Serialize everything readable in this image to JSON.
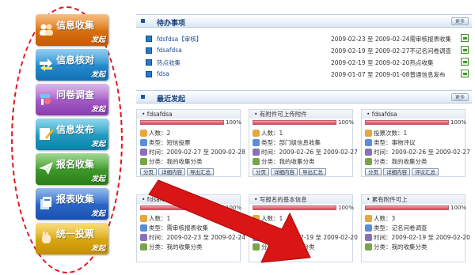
{
  "sidebar": {
    "tiles": [
      {
        "label": "信息收集",
        "launch": "发起",
        "color": "#f08a1c",
        "dark": "#c45a06",
        "icon": "people-icon"
      },
      {
        "label": "信息核对",
        "launch": "发起",
        "color": "#3aa7e6",
        "dark": "#1370b5",
        "icon": "exchange-arrows-icon"
      },
      {
        "label": "问卷调查",
        "launch": "发起",
        "color": "#c07ddb",
        "dark": "#8a3cb0",
        "icon": "tools-icon"
      },
      {
        "label": "信息发布",
        "launch": "发起",
        "color": "#35b8dc",
        "dark": "#0f80a8",
        "icon": "edit-pen-icon"
      },
      {
        "label": "报名收集",
        "launch": "发起",
        "color": "#52b83a",
        "dark": "#2a7d18",
        "icon": "paper-plane-icon"
      },
      {
        "label": "报表收集",
        "launch": "发起",
        "color": "#3d7fe0",
        "dark": "#1a4fae",
        "icon": "document-stack-icon"
      },
      {
        "label": "统一投票",
        "launch": "发起",
        "color": "#f2c21d",
        "dark": "#c48e06",
        "icon": "hand-icon"
      }
    ]
  },
  "todo": {
    "title": "待办事项",
    "more": "更多",
    "items": [
      {
        "name": "fdsfdsa【审核】",
        "desc": "2009-02-23 至 2009-02-24需审核报表收集"
      },
      {
        "name": "fdsafdsa",
        "desc": "2009-02-19 至 2009-02-27不记名问卷调查"
      },
      {
        "name": "热点收集",
        "desc": "2009-02-19 至 2009-02-20热点收集"
      },
      {
        "name": "fdsa",
        "desc": "2009-01-07 至 2009-01-08普通信息发布"
      }
    ]
  },
  "recent": {
    "title": "最近发起",
    "more": "更多",
    "cards": [
      {
        "title": "fdsafdsa",
        "percent": "100%",
        "fill": 1.0,
        "lines": [
          "人数：2",
          "类型：短信投票",
          "时间：2009-02-27 至 2009-02-28",
          "分类：我的收集分类"
        ],
        "buttons": [
          "分页",
          "详细内容",
          "导出汇总"
        ]
      },
      {
        "title": "有附件可上传附件",
        "percent": "100%",
        "fill": 1.0,
        "lines": [
          "人数：1",
          "类型：部门级信息收集",
          "时间：2009-02-26 至 2009-02-27",
          "分类：我的收集分类"
        ],
        "buttons": [
          "分页",
          "详细内容",
          "导出汇总"
        ]
      },
      {
        "title": "fdsafdsa",
        "percent": "100%",
        "fill": 1.0,
        "lines": [
          "投票次数：1",
          "类型：事物评议",
          "时间：2009-02-26 至 2009-02-27",
          "分类：我的收集分类"
        ],
        "buttons": [
          "分页",
          "详细内容",
          "评议汇总"
        ]
      },
      {
        "title": "fdsafdsa",
        "percent": "100%",
        "fill": 1.0,
        "lines": [
          "人数：1",
          "类型：需审核报表收集",
          "时间：2009-02-23 至 2009-02-24",
          "分类：我的收集分类"
        ],
        "buttons": []
      },
      {
        "title": "写报名的基本信息",
        "percent": "100%",
        "fill": 1.0,
        "lines": [
          "人数：1",
          "类型：",
          "时间：2009-02-19 至 2009-02-20",
          "分类：我的收集分类"
        ],
        "buttons": []
      },
      {
        "title": "累有附件可上",
        "percent": "100%",
        "fill": 1.0,
        "lines": [
          "人数：3",
          "类型：记名问卷调查",
          "时间：2009-02-19 至 2009-02-20",
          "分类：我的收集分类"
        ],
        "buttons": []
      }
    ]
  },
  "colors": {
    "oval": "#e0141a",
    "arrow": "#d91515",
    "header": "#1a3f78"
  }
}
